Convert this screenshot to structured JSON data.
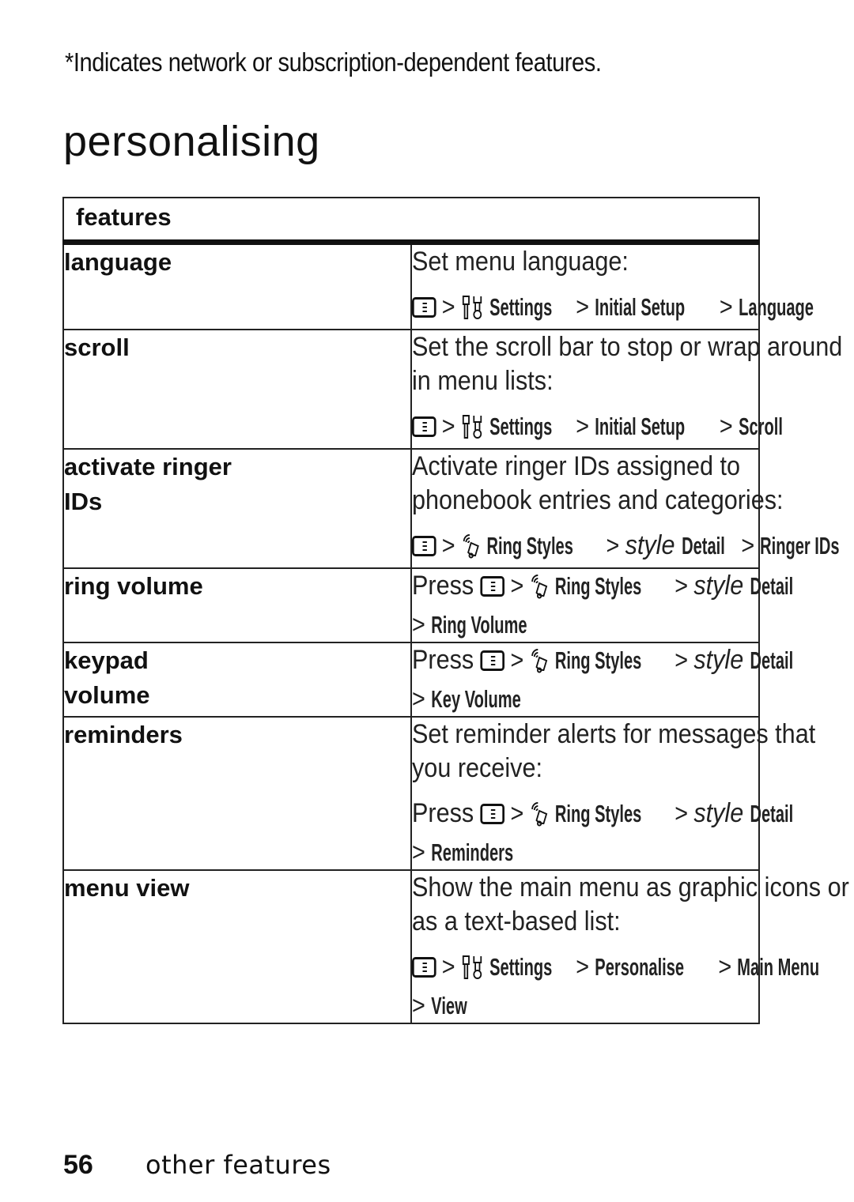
{
  "note": "*Indicates network or  subscription-dependent  features.",
  "title": "personalising",
  "table": {
    "header": "features",
    "rows": [
      {
        "name_lines": [
          "language"
        ],
        "desc_lines": [
          "Set menu language:"
        ],
        "path": {
          "prefix": "",
          "icon": "settings-icon",
          "steps": [
            "Settings",
            "Initial Setup",
            "Language"
          ]
        }
      },
      {
        "name_lines": [
          "scroll"
        ],
        "desc_lines": [
          "Set the scroll bar to stop or wrap around",
          "in menu lists:"
        ],
        "path": {
          "prefix": "",
          "icon": "settings-icon",
          "steps": [
            "Settings",
            "Initial Setup",
            "Scroll"
          ]
        }
      },
      {
        "name_lines": [
          "activate ringer",
          "IDs"
        ],
        "desc_lines": [
          "Activate ringer IDs assigned to",
          "phonebook entries and categories:"
        ],
        "path": {
          "prefix": "",
          "icon": "ring-styles-icon",
          "steps": [
            "Ring Styles",
            "style Detail",
            "Ringer IDs"
          ]
        }
      },
      {
        "name_lines": [
          "ring volume"
        ],
        "desc_lines": [],
        "path": {
          "prefix": "Press",
          "icon": "ring-styles-icon",
          "steps": [
            "Ring Styles",
            "style Detail",
            "Ring Volume"
          ]
        }
      },
      {
        "name_lines": [
          "keypad",
          "volume"
        ],
        "desc_lines": [],
        "path": {
          "prefix": "Press",
          "icon": "ring-styles-icon",
          "steps": [
            "Ring Styles",
            "style Detail",
            "Key Volume"
          ]
        }
      },
      {
        "name_lines": [
          "reminders"
        ],
        "desc_lines": [
          "Set reminder alerts for messages that",
          "you receive:"
        ],
        "path": {
          "prefix": "Press",
          "icon": "ring-styles-icon",
          "steps": [
            "Ring Styles",
            "style Detail",
            "Reminders"
          ]
        }
      },
      {
        "name_lines": [
          "menu view"
        ],
        "desc_lines": [
          "Show the main menu as graphic icons or",
          "as a text-based list:"
        ],
        "path": {
          "prefix": "",
          "icon": "settings-icon",
          "steps": [
            "Settings",
            "Personalise",
            "Main Menu",
            "View"
          ]
        }
      }
    ],
    "italic_word": "style",
    "separator": ">"
  },
  "footer": {
    "page_number": "56",
    "section": "other features"
  }
}
